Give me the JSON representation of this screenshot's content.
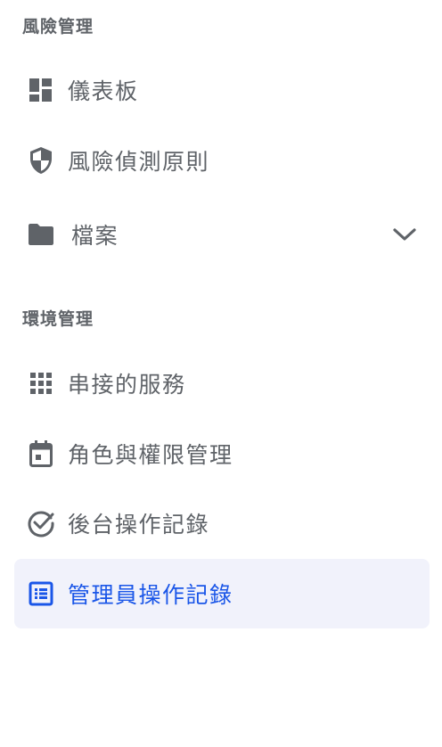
{
  "sections": [
    {
      "title": "風險管理",
      "items": [
        {
          "label": "儀表板",
          "icon": "dashboard-icon"
        },
        {
          "label": "風險偵測原則",
          "icon": "shield-icon"
        },
        {
          "label": "檔案",
          "icon": "folder-icon",
          "expandable": true,
          "expand_icon": "chevron-down-icon"
        }
      ]
    },
    {
      "title": "環境管理",
      "items": [
        {
          "label": "串接的服務",
          "icon": "apps-grid-icon"
        },
        {
          "label": "角色與權限管理",
          "icon": "calendar-icon"
        },
        {
          "label": "後台操作記錄",
          "icon": "check-circle-icon"
        },
        {
          "label": "管理員操作記錄",
          "icon": "list-icon",
          "active": true
        }
      ]
    }
  ],
  "colors": {
    "text": "#5f6368",
    "active_text": "#1a56e8",
    "active_background": "#f1f2fb"
  }
}
